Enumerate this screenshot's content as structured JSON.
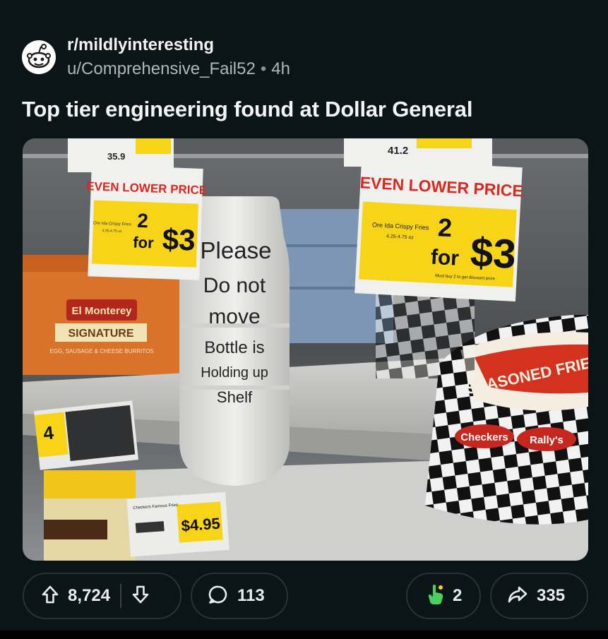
{
  "post": {
    "subreddit": "r/mildlyinteresting",
    "username": "u/Comprehensive_Fail52",
    "separator": "•",
    "time_ago": "4h",
    "title": "Top tier engineering found at Dollar General"
  },
  "image": {
    "left_sign": {
      "headline": "EVEN LOWER PRICE",
      "deal_qty": "2",
      "deal_for": "for",
      "deal_price": "$3",
      "product": "Ore Ida Crispy Fries",
      "size": "4.25-4.75 oz"
    },
    "right_sign": {
      "headline": "EVEN LOWER PRICE",
      "deal_qty": "2",
      "deal_for": "for",
      "deal_price": "$3",
      "product": "Ore Ida Crispy Fries",
      "size": "4.25-4.75 oz",
      "note": "Must buy 2 to get discount price"
    },
    "bottle_note": [
      "Please",
      "Do not",
      "move",
      "Bottle is",
      "Holding up",
      "Shelf"
    ],
    "box_brand": "El Monterey",
    "box_line": "SIGNATURE",
    "box_sub": "EGG, SAUSAGE & CHEESE BURRITOS",
    "bag_text": "SEASONED FRIES",
    "bag_brand_1": "Checkers",
    "bag_brand_2": "Rally's",
    "shelf_tag_price": "$4.95",
    "shelf_tag_product": "Checkers Famous Fries",
    "top_tag_price": "41.2",
    "top_tag_price_left": "35.9",
    "left_tag_digit": "4"
  },
  "actions": {
    "upvotes": "8,724",
    "comments": "113",
    "awards": "2",
    "shares": "335"
  },
  "colors": {
    "background": "#0b1416",
    "pill_border": "#2b3236",
    "sign_yellow": "#f7d417",
    "sign_red": "#d9281f",
    "award_green": "#46d160"
  }
}
